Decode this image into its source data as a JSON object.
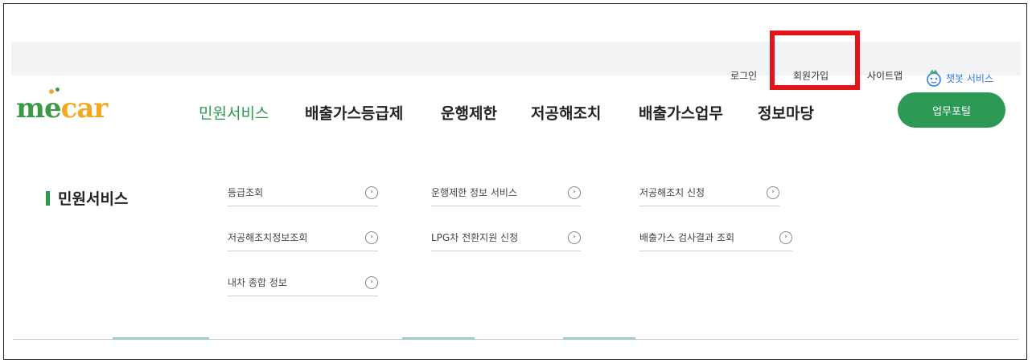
{
  "utility": {
    "login": "로그인",
    "signup": "회원가입",
    "sitemap": "사이트맵",
    "chatbot": "챗봇 서비스"
  },
  "logo": {
    "m": "m",
    "e": "e",
    "car": "car"
  },
  "gnb": {
    "items": [
      "민원서비스",
      "배출가스등급제",
      "운행제한",
      "저공해조치",
      "배출가스업무",
      "정보마당"
    ],
    "active_index": 0
  },
  "portal_button": "업무포털",
  "section_title": "민원서비스",
  "submenu": {
    "col1": [
      "등급조회",
      "저공해조치정보조회",
      "내차 종합 정보"
    ],
    "col2": [
      "운행제한 정보 서비스",
      "LPG차 전환지원 신청"
    ],
    "col3": [
      "저공해조치 신청",
      "배출가스 검사결과 조회"
    ]
  },
  "colors": {
    "brand_green": "#2b9a4f",
    "logo_orange": "#f2a922",
    "highlight_red": "#e4141b",
    "chatbot_blue": "#2a7de1"
  },
  "icons": {
    "chatbot": "chatbot-icon",
    "arrow": "circle-arrow-icon"
  }
}
